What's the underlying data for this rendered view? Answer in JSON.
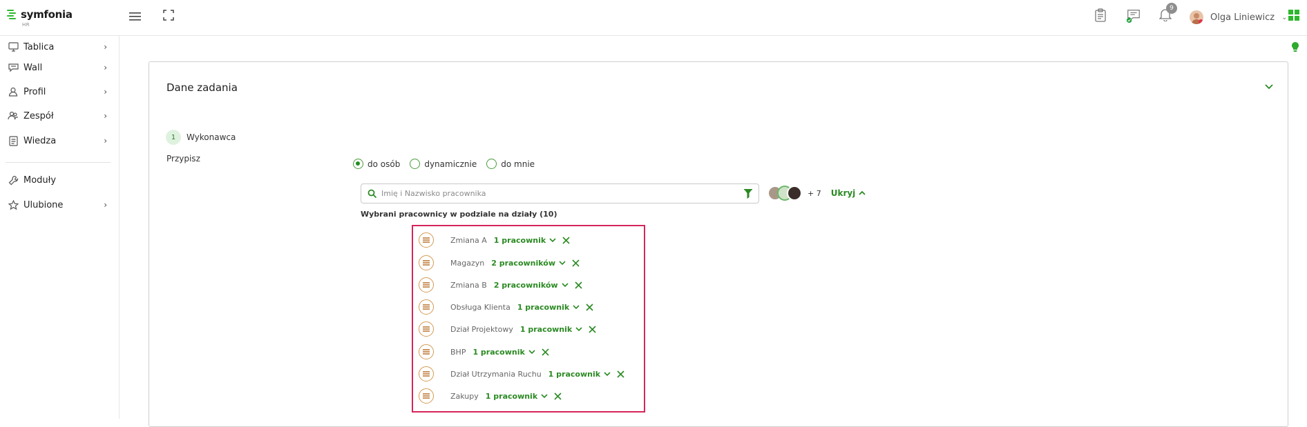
{
  "header": {
    "brand": "symfonia",
    "brand_sub": "HR",
    "notification_count": "9",
    "user_name": "Olga Liniewicz",
    "icons": [
      "hamburger-icon",
      "fullscreen-icon",
      "clipboard-icon",
      "chat-icon",
      "bell-icon",
      "apps-icon"
    ]
  },
  "sidebar": {
    "items": [
      {
        "label": "Tablica",
        "icon": "monitor-icon",
        "has_arrow": true
      },
      {
        "label": "Wall",
        "icon": "speech-icon",
        "has_arrow": true
      },
      {
        "label": "Profil",
        "icon": "user-icon",
        "has_arrow": true
      },
      {
        "label": "Zespół",
        "icon": "team-icon",
        "has_arrow": true
      },
      {
        "label": "Wiedza",
        "icon": "document-icon",
        "has_arrow": true
      },
      {
        "label": "Moduły",
        "icon": "wrench-icon",
        "has_arrow": false
      },
      {
        "label": "Ulubione",
        "icon": "star-icon",
        "has_arrow": true
      }
    ]
  },
  "card": {
    "title": "Dane zadania",
    "step_number": "1",
    "step_label": "Wykonawca",
    "assign_label": "Przypisz",
    "radios": [
      {
        "label": "do osób",
        "checked": true
      },
      {
        "label": "dynamicznie",
        "checked": false
      },
      {
        "label": "do mnie",
        "checked": false
      }
    ],
    "search_placeholder": "Imię i Nazwisko pracownika",
    "more_count": "+ 7",
    "hide_label": "Ukryj",
    "selected_title": "Wybrani pracownicy w podziale na działy (10)",
    "groups": [
      {
        "name": "Zmiana A",
        "count": "1 pracownik"
      },
      {
        "name": "Magazyn",
        "count": "2 pracowników"
      },
      {
        "name": "Zmiana B",
        "count": "2 pracowników"
      },
      {
        "name": "Obsługa Klienta",
        "count": "1 pracownik"
      },
      {
        "name": "Dział Projektowy",
        "count": "1 pracownik"
      },
      {
        "name": "BHP",
        "count": "1 pracownik"
      },
      {
        "name": "Dział Utrzymania Ruchu",
        "count": "1 pracownik"
      },
      {
        "name": "Zakupy",
        "count": "1 pracownik"
      }
    ]
  },
  "colors": {
    "accent_green": "#2a8a22",
    "highlight_border": "#d6245a",
    "handle_border": "#d49a52"
  }
}
